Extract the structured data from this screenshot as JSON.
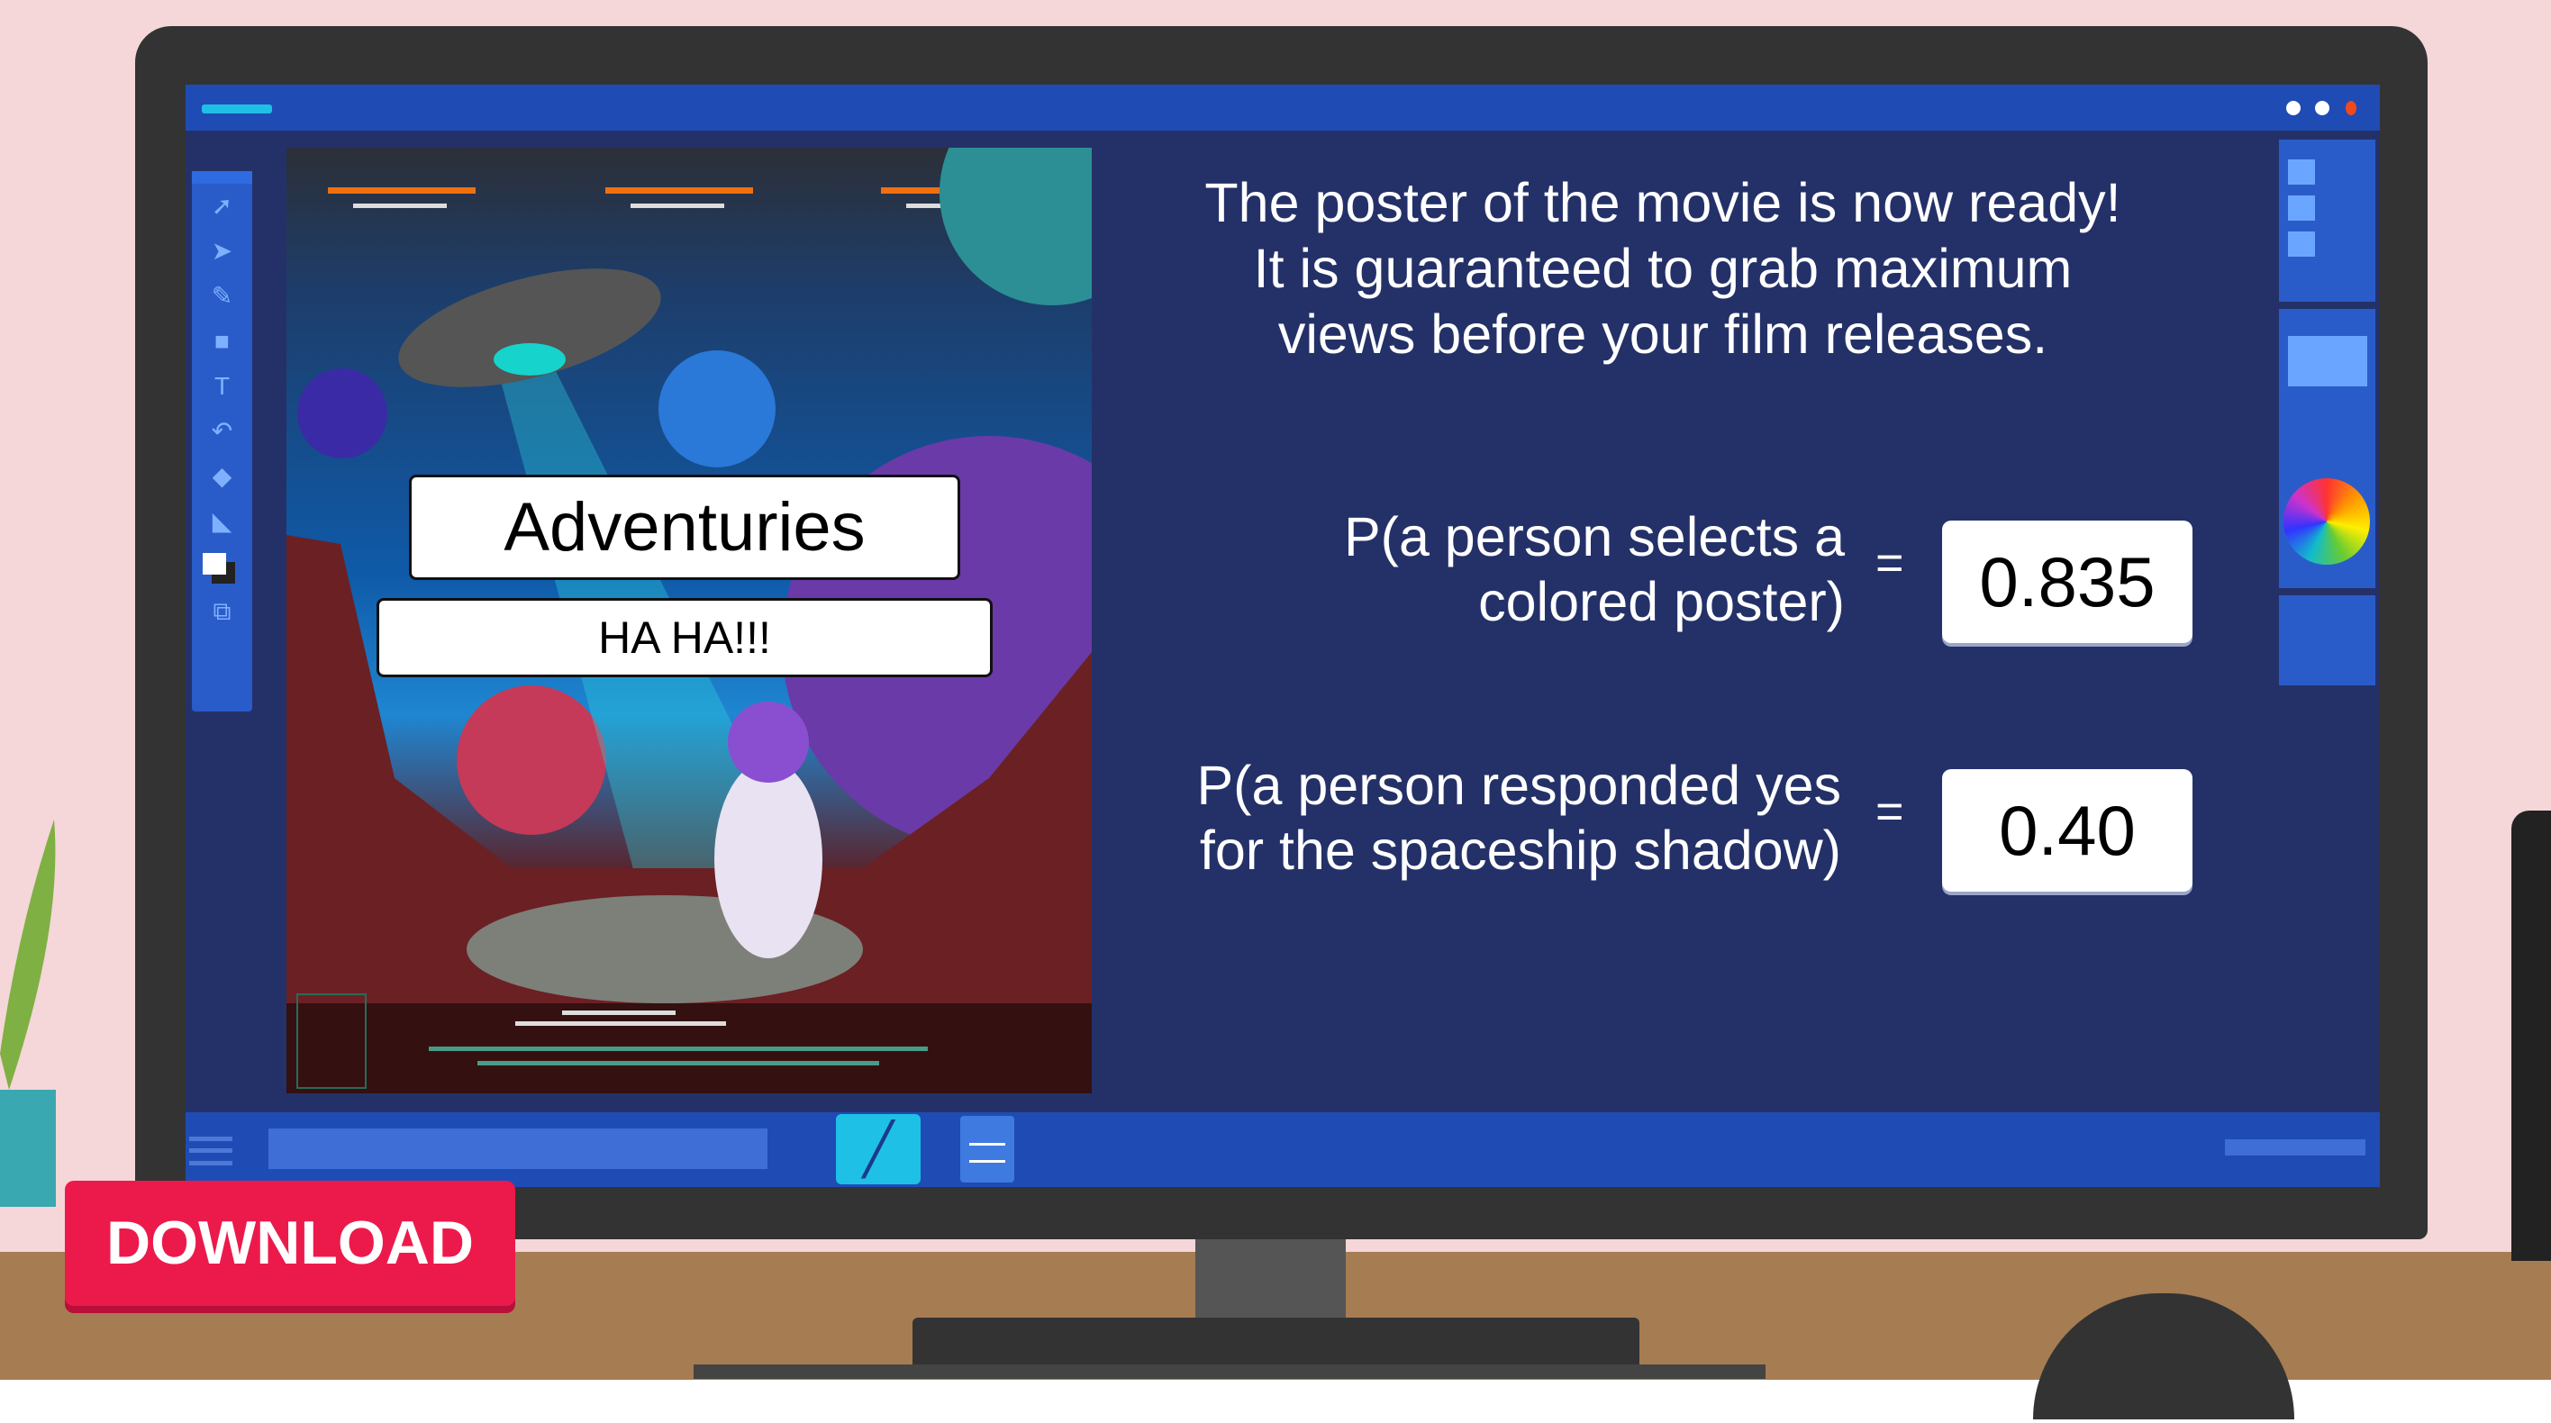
{
  "poster": {
    "title": "Adventuries",
    "subtitle": "HA HA!!!"
  },
  "message": {
    "line1": "The poster of the movie is now ready!",
    "line2": "It is guaranteed to grab maximum",
    "line3": "views before your film releases."
  },
  "probabilities": [
    {
      "label_line1": "P(a person selects a",
      "label_line2": "colored poster)",
      "equals": "=",
      "value": "0.835"
    },
    {
      "label_line1": "P(a person responded yes",
      "label_line2": "for the spaceship shadow)",
      "equals": "=",
      "value": "0.40"
    }
  ],
  "download_label": "DOWNLOAD",
  "toolbar": {
    "icons": [
      "cursor-icon",
      "direct-select-icon",
      "pen-icon",
      "rectangle-icon",
      "text-icon",
      "undo-icon",
      "eraser-icon",
      "transform-icon",
      "color-swatch-icon",
      "arrange-icon"
    ],
    "glyphs": [
      "➚",
      "➤",
      "✎",
      "■",
      "T",
      "↶",
      "◆",
      "◣",
      "◧",
      "⧉"
    ]
  },
  "colors": {
    "screen": "#243168",
    "bar": "#1f4bb5",
    "accent": "#1ec0e6",
    "download": "#ec1a4b",
    "background": "#f5d6d9",
    "desk": "#a67c52"
  }
}
